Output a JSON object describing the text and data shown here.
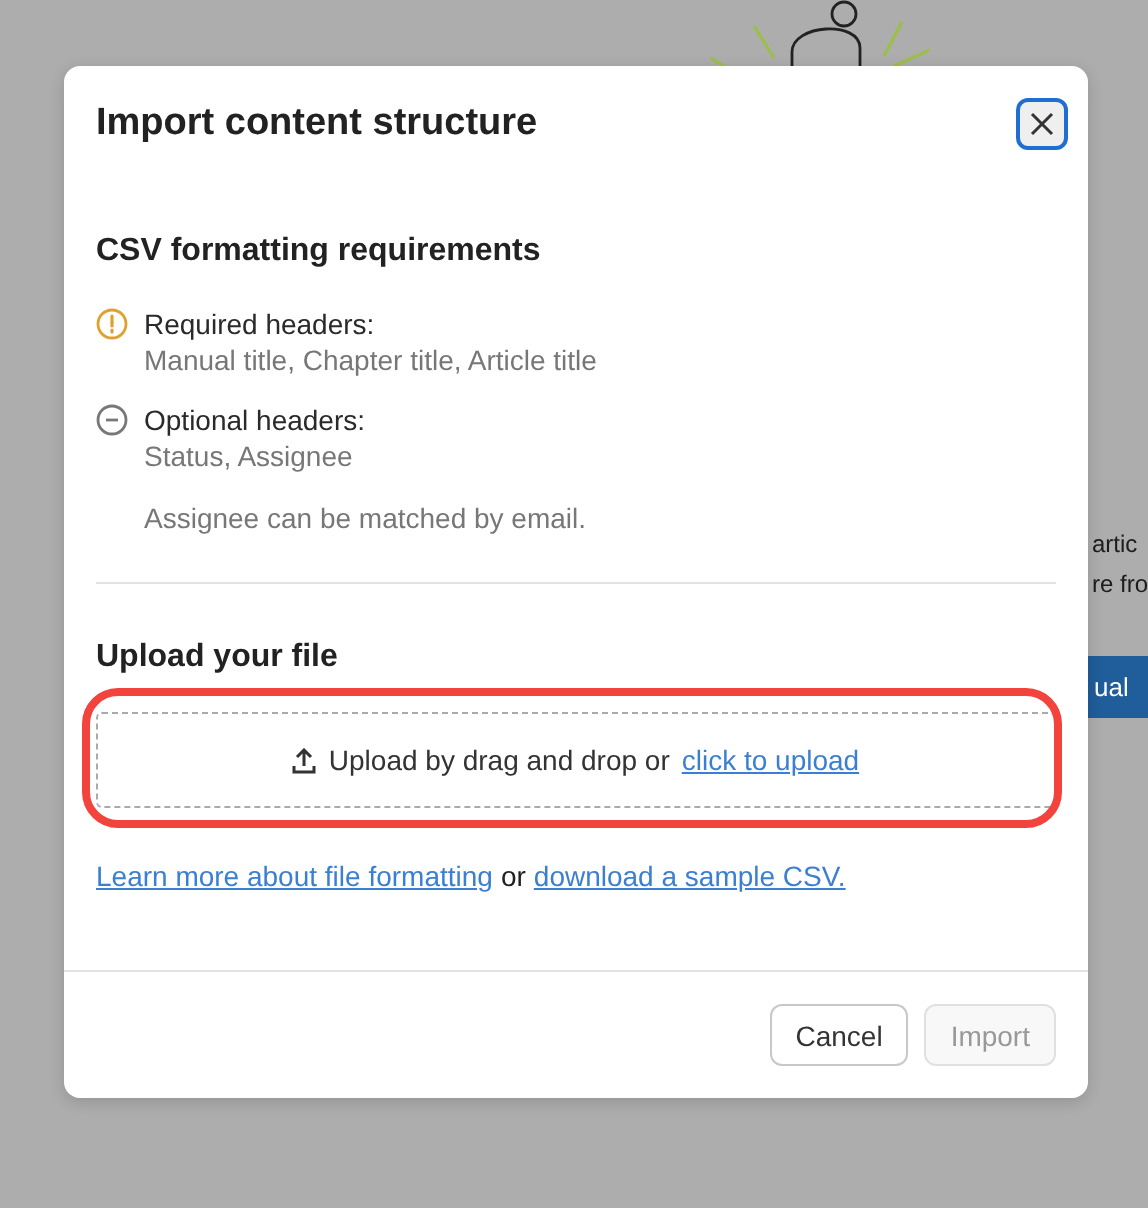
{
  "background": {
    "texts": [
      "artic",
      "re fro"
    ],
    "button": "ual"
  },
  "dialog": {
    "title": "Import content structure",
    "requirements": {
      "heading": "CSV formatting requirements",
      "items": [
        {
          "kind": "required",
          "label": "Required headers:",
          "value": "Manual title, Chapter title, Article title"
        },
        {
          "kind": "optional",
          "label": "Optional headers:",
          "value": "Status, Assignee"
        }
      ],
      "note": "Assignee can be matched by email."
    },
    "upload": {
      "heading": "Upload your file",
      "prompt": "Upload by drag and drop or",
      "link": "click to upload",
      "highlighted": true
    },
    "help": {
      "link1": "Learn more about file formatting ",
      "joiner": "or",
      "link2": "download a sample CSV."
    },
    "buttons": [
      {
        "label": "Cancel",
        "disabled": false
      },
      {
        "label": "Import",
        "disabled": true
      }
    ]
  }
}
